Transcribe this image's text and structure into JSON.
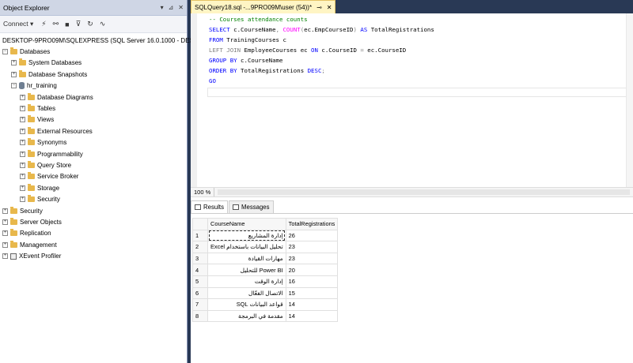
{
  "object_explorer": {
    "title": "Object Explorer",
    "title_controls": [
      "▾",
      "⊿",
      "✕"
    ],
    "toolbar": {
      "connect_label": "Connect ▾",
      "icons": [
        "connect-icon",
        "disconnect-icon",
        "stop-icon",
        "filter-icon",
        "refresh-icon",
        "activity-icon"
      ]
    },
    "server": "DESKTOP-9PRO09M\\SQLEXPRESS (SQL Server 16.0.1000 - DESKTOP-9PRO",
    "tree": [
      {
        "label": "Databases",
        "level": 0,
        "expander": "−",
        "icon": "folder"
      },
      {
        "label": "System Databases",
        "level": 1,
        "expander": "+",
        "icon": "folder"
      },
      {
        "label": "Database Snapshots",
        "level": 1,
        "expander": "+",
        "icon": "folder"
      },
      {
        "label": "hr_training",
        "level": 1,
        "expander": "−",
        "icon": "db"
      },
      {
        "label": "Database Diagrams",
        "level": 2,
        "expander": "+",
        "icon": "folder"
      },
      {
        "label": "Tables",
        "level": 2,
        "expander": "+",
        "icon": "folder"
      },
      {
        "label": "Views",
        "level": 2,
        "expander": "+",
        "icon": "folder"
      },
      {
        "label": "External Resources",
        "level": 2,
        "expander": "+",
        "icon": "folder"
      },
      {
        "label": "Synonyms",
        "level": 2,
        "expander": "+",
        "icon": "folder"
      },
      {
        "label": "Programmability",
        "level": 2,
        "expander": "+",
        "icon": "folder"
      },
      {
        "label": "Query Store",
        "level": 2,
        "expander": "+",
        "icon": "folder"
      },
      {
        "label": "Service Broker",
        "level": 2,
        "expander": "+",
        "icon": "folder"
      },
      {
        "label": "Storage",
        "level": 2,
        "expander": "+",
        "icon": "folder"
      },
      {
        "label": "Security",
        "level": 2,
        "expander": "+",
        "icon": "folder"
      },
      {
        "label": "Security",
        "level": 0,
        "expander": "+",
        "icon": "folder"
      },
      {
        "label": "Server Objects",
        "level": 0,
        "expander": "+",
        "icon": "folder"
      },
      {
        "label": "Replication",
        "level": 0,
        "expander": "+",
        "icon": "folder"
      },
      {
        "label": "Management",
        "level": 0,
        "expander": "+",
        "icon": "folder"
      },
      {
        "label": "XEvent Profiler",
        "level": 0,
        "expander": "+",
        "icon": "xe"
      }
    ]
  },
  "editor": {
    "tab_label": "SQLQuery18.sql -...9PRO09M\\user (54))*",
    "tab_pin": "⊸",
    "tab_close": "✕",
    "zoom": "100 %",
    "code_lines": [
      [
        {
          "t": "-- Courses attendance counts",
          "c": "cm"
        }
      ],
      [
        {
          "t": "SELECT ",
          "c": "kw"
        },
        {
          "t": "c.CourseName",
          "c": ""
        },
        {
          "t": ", ",
          "c": "gr"
        },
        {
          "t": "COUNT",
          "c": "fn"
        },
        {
          "t": "(",
          "c": "gr"
        },
        {
          "t": "ec.EmpCourseID",
          "c": ""
        },
        {
          "t": ") ",
          "c": "gr"
        },
        {
          "t": "AS ",
          "c": "kw"
        },
        {
          "t": "TotalRegistrations",
          "c": ""
        }
      ],
      [
        {
          "t": "FROM ",
          "c": "kw"
        },
        {
          "t": "TrainingCourses c",
          "c": ""
        }
      ],
      [
        {
          "t": "LEFT JOIN ",
          "c": "gr"
        },
        {
          "t": "EmployeeCourses ec ",
          "c": ""
        },
        {
          "t": "ON ",
          "c": "kw"
        },
        {
          "t": "c.CourseID ",
          "c": ""
        },
        {
          "t": "= ",
          "c": "gr"
        },
        {
          "t": "ec.CourseID",
          "c": ""
        }
      ],
      [
        {
          "t": "GROUP BY ",
          "c": "kw"
        },
        {
          "t": "c.CourseName",
          "c": ""
        }
      ],
      [
        {
          "t": "ORDER BY ",
          "c": "kw"
        },
        {
          "t": "TotalRegistrations ",
          "c": ""
        },
        {
          "t": "DESC",
          "c": "kw"
        },
        {
          "t": ";",
          "c": "gr"
        }
      ],
      [
        {
          "t": "GO",
          "c": "kw"
        }
      ]
    ]
  },
  "results": {
    "tabs": [
      {
        "label": "Results",
        "active": true
      },
      {
        "label": "Messages",
        "active": false
      }
    ],
    "columns": [
      "CourseName",
      "TotalRegistrations"
    ],
    "rows": [
      {
        "n": "1",
        "name": "إدارة المشاريع",
        "total": "26"
      },
      {
        "n": "2",
        "name": "تحليل البيانات باستخدام Excel",
        "total": "23"
      },
      {
        "n": "3",
        "name": "مهارات القيادة",
        "total": "23"
      },
      {
        "n": "4",
        "name": "Power BI للتحليل",
        "total": "20"
      },
      {
        "n": "5",
        "name": "إدارة الوقت",
        "total": "16"
      },
      {
        "n": "6",
        "name": "الاتصال الفعّال",
        "total": "15"
      },
      {
        "n": "7",
        "name": "قواعد البيانات SQL",
        "total": "14"
      },
      {
        "n": "8",
        "name": "مقدمة في البرمجة",
        "total": "14"
      }
    ]
  }
}
